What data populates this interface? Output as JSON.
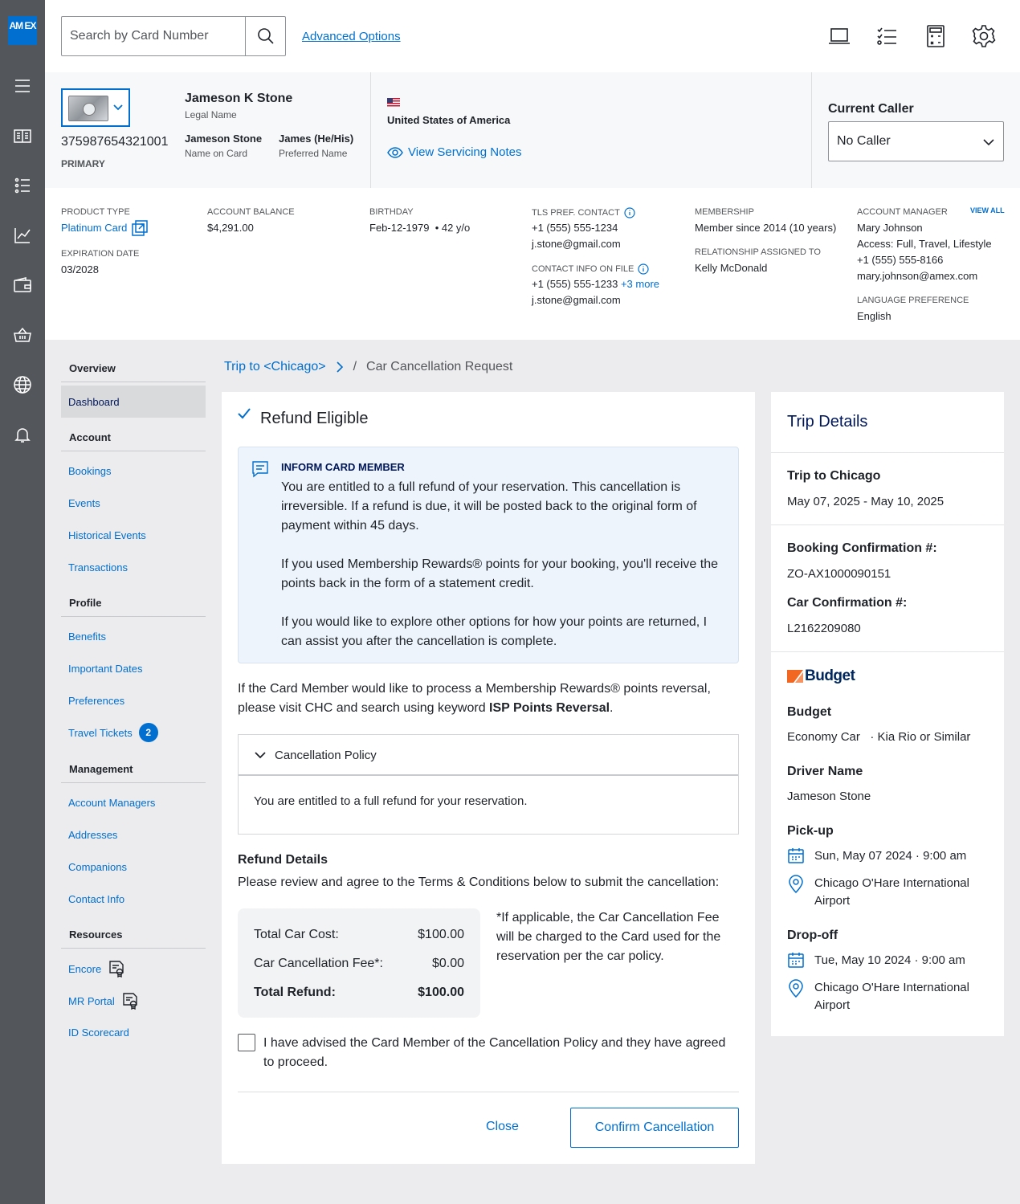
{
  "brand": {
    "logo_text": "AM EX",
    "accent": "#006fcf"
  },
  "rail_icons": [
    "menu-icon",
    "book-icon",
    "list-icon",
    "chart-icon",
    "wallet-icon",
    "basket-icon",
    "globe-icon",
    "bell-icon"
  ],
  "search": {
    "placeholder": "Search by Card Number",
    "advanced": "Advanced Options"
  },
  "toolbar_icons": [
    "laptop-icon",
    "checklist-icon",
    "calculator-icon",
    "settings-icon"
  ],
  "profile": {
    "card_number": "375987654321001",
    "card_role": "PRIMARY",
    "legal_name": "Jameson K Stone",
    "legal_name_label": "Legal Name",
    "name_on_card": "Jameson Stone",
    "name_on_card_label": "Name on Card",
    "preferred_name": "James (He/His)",
    "preferred_name_label": "Preferred Name",
    "country": "United States of America",
    "servicing_notes": "View Servicing Notes",
    "current_caller_label": "Current Caller",
    "current_caller_value": "No Caller"
  },
  "account": {
    "product_type_label": "PRODUCT TYPE",
    "product_type": "Platinum Card",
    "expiration_label": "EXPIRATION DATE",
    "expiration": "03/2028",
    "balance_label": "ACCOUNT BALANCE",
    "balance": "$4,291.00",
    "birthday_label": "BIRTHDAY",
    "birthday": "Feb-12-1979",
    "age": "• 42 y/o",
    "tls_label": "TLS PREF. CONTACT",
    "tls_phone": "+1 (555) 555-1234",
    "tls_email": "j.stone@gmail.com",
    "contact_label": "CONTACT INFO ON FILE",
    "contact_phone": "+1 (555) 555-1233",
    "contact_more": "+3 more",
    "contact_email": "j.stone@gmail.com",
    "membership_label": "MEMBERSHIP",
    "membership": "Member since 2014 (10 years)",
    "relationship_label": "RELATIONSHIP ASSIGNED TO",
    "relationship": "Kelly McDonald",
    "manager_label": "ACCOUNT MANAGER",
    "view_all": "VIEW ALL",
    "manager_name": "Mary Johnson",
    "manager_access": "Access: Full, Travel, Lifestyle",
    "manager_phone": "+1 (555) 555-8166",
    "manager_email": "mary.johnson@amex.com",
    "language_label": "LANGUAGE PREFERENCE",
    "language": "English"
  },
  "nav": {
    "overview": "Overview",
    "dashboard": "Dashboard",
    "account": "Account",
    "bookings": "Bookings",
    "events": "Events",
    "historical_events": "Historical Events",
    "transactions": "Transactions",
    "profile": "Profile",
    "benefits": "Benefits",
    "important_dates": "Important Dates",
    "preferences": "Preferences",
    "travel_tickets": "Travel Tickets",
    "travel_tickets_count": "2",
    "management": "Management",
    "account_managers": "Account Managers",
    "addresses": "Addresses",
    "companions": "Companions",
    "contact_info": "Contact Info",
    "resources": "Resources",
    "encore": "Encore",
    "mr_portal": "MR Portal",
    "id_scorecard": "ID Scorecard"
  },
  "breadcrumb": {
    "parent": "Trip to <Chicago>",
    "separator": "/",
    "current": "Car Cancellation Request"
  },
  "main": {
    "status": "Refund Eligible",
    "inform_title": "INFORM CARD MEMBER",
    "inform_p1": "You are entitled to a full refund of your reservation. This cancellation is irreversible. If a refund is due, it will be posted back to the original form of payment within 45 days.",
    "inform_p2": "If you used Membership Rewards® points for your booking, you'll receive the points back in the form of a statement credit.",
    "inform_p3": "If you would like to explore other options for how your points are returned, I can assist you after the cancellation is complete.",
    "reversal_text": "If the Card Member would like to process a Membership Rewards® points reversal, please visit CHC and search using keyword ",
    "reversal_keyword": "ISP Points Reversal",
    "reversal_end": ".",
    "policy_title": "Cancellation Policy",
    "policy_body": "You are entitled to a full refund for your reservation.",
    "refund_title": "Refund Details",
    "refund_intro": "Please review and agree to the Terms & Conditions below to submit the cancellation:",
    "total_car_cost_label": "Total Car Cost:",
    "total_car_cost": "$100.00",
    "fee_label": "Car Cancellation Fee*:",
    "fee": "$0.00",
    "total_refund_label": "Total Refund:",
    "total_refund": "$100.00",
    "fee_note": "*If applicable, the Car Cancellation Fee will be charged to the Card used for the reservation per the car policy.",
    "agree_text": "I have advised the Card Member of the Cancellation Policy and they have agreed to proceed.",
    "close": "Close",
    "confirm": "Confirm Cancellation"
  },
  "trip": {
    "title": "Trip Details",
    "trip_name": "Trip to Chicago",
    "trip_dates": "May 07, 2025 - May 10, 2025",
    "booking_label": "Booking Confirmation #:",
    "booking_number": "ZO-AX1000090151",
    "car_label": "Car Confirmation #:",
    "car_number": "L2162209080",
    "vendor_logo": "Budget",
    "vendor": "Budget",
    "car_class": "Economy Car",
    "car_model": "· Kia Rio or Similar",
    "driver_label": "Driver Name",
    "driver": "Jameson Stone",
    "pickup_label": "Pick-up",
    "pickup_date": "Sun, May 07 2024 · 9:00 am",
    "pickup_location": "Chicago O'Hare International Airport",
    "dropoff_label": "Drop-off",
    "dropoff_date": "Tue, May 10 2024 · 9:00 am",
    "dropoff_location": "Chicago O'Hare International Airport"
  }
}
